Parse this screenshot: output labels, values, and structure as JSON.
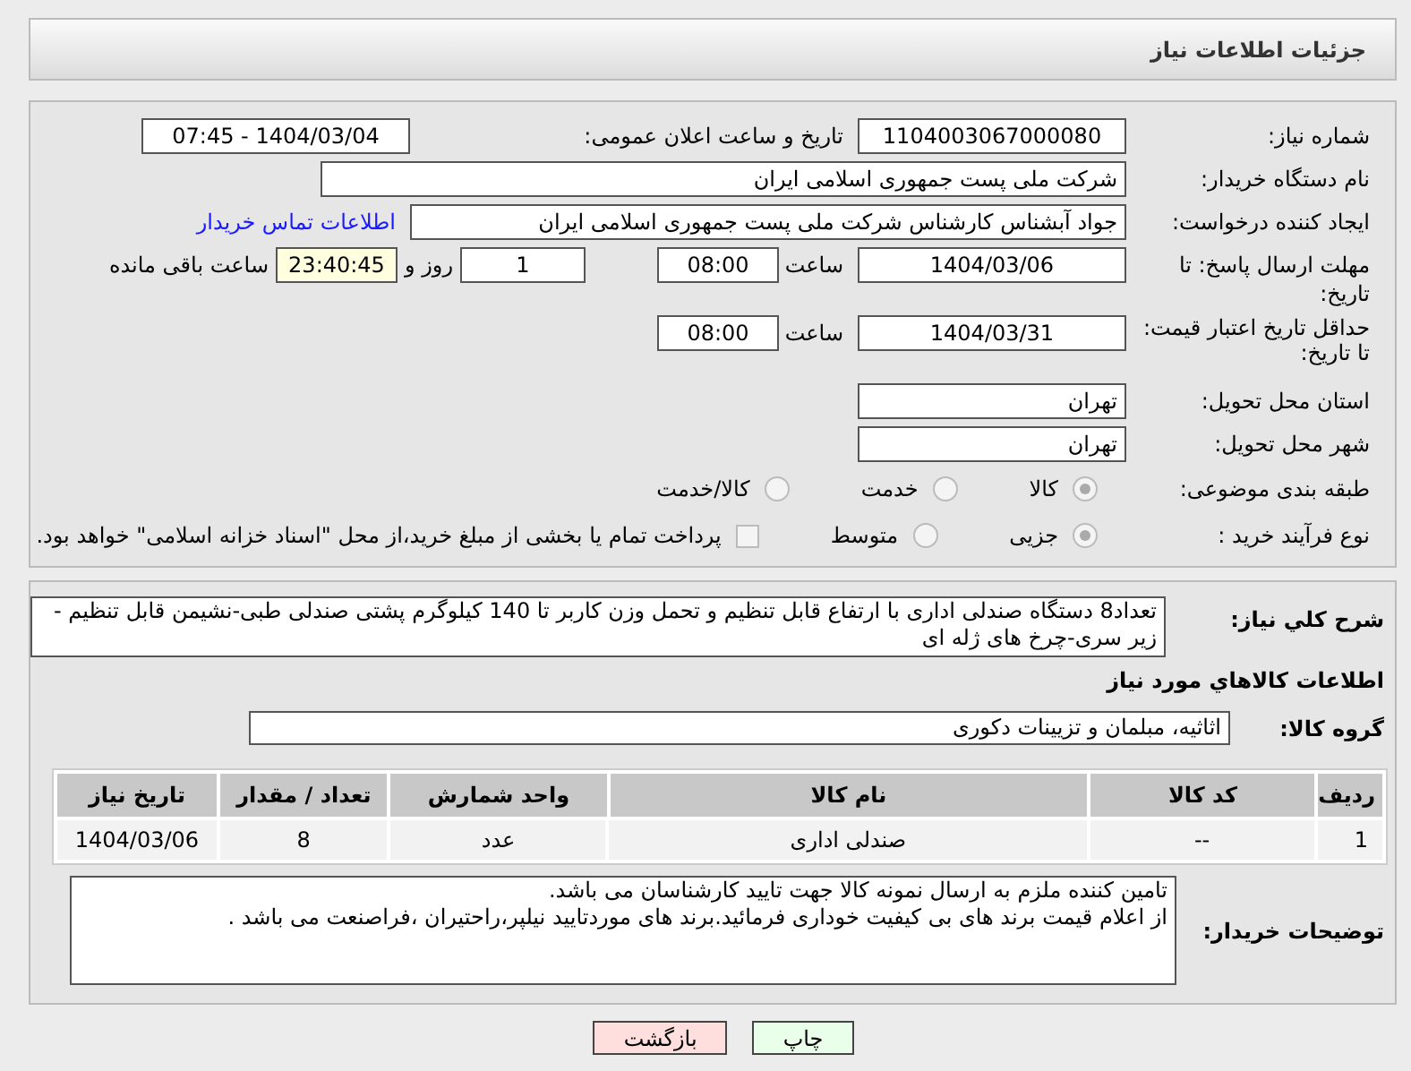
{
  "header": {
    "title": "جزئیات اطلاعات نیاز"
  },
  "need_number": {
    "label": "شماره نیاز:",
    "value": "1104003067000080"
  },
  "announce": {
    "label": "تاریخ و ساعت اعلان عمومی:",
    "value": "1404/03/04 - 07:45"
  },
  "buyer": {
    "label": "نام دستگاه خریدار:",
    "value": "شرکت ملی پست جمهوری اسلامی ایران"
  },
  "creator": {
    "label": "ایجاد کننده درخواست:",
    "value": "جواد آبشناس کارشناس شرکت ملی پست جمهوری اسلامی ایران",
    "link": "اطلاعات تماس خریدار"
  },
  "deadline": {
    "label": "مهلت ارسال پاسخ: تا تاریخ:",
    "date": "1404/03/06",
    "time_label": "ساعت",
    "time": "08:00",
    "days": "1",
    "days_label": "روز و",
    "remaining": "23:40:45",
    "remaining_label": "ساعت باقی مانده"
  },
  "validity": {
    "label": "حداقل تاریخ اعتبار قیمت: تا تاریخ:",
    "date": "1404/03/31",
    "time_label": "ساعت",
    "time": "08:00"
  },
  "province": {
    "label": "استان محل تحویل:",
    "value": "تهران"
  },
  "city": {
    "label": "شهر محل تحویل:",
    "value": "تهران"
  },
  "category": {
    "label": "طبقه بندی موضوعی:",
    "options": [
      {
        "label": "کالا",
        "selected": true
      },
      {
        "label": "خدمت",
        "selected": false
      },
      {
        "label": "کالا/خدمت",
        "selected": false
      }
    ]
  },
  "process": {
    "label": "نوع فرآیند خرید :",
    "options": [
      {
        "label": "جزیی",
        "selected": true
      },
      {
        "label": "متوسط",
        "selected": false
      }
    ],
    "payment": {
      "checked": false,
      "text": "پرداخت تمام یا بخشی از مبلغ خرید،از محل \"اسناد خزانه اسلامی\" خواهد بود."
    }
  },
  "description": {
    "label": "شرح کلي نياز:",
    "value": "تعداد8 دستگاه صندلی اداری با ارتفاع قابل تنظیم و تحمل وزن کاربر تا 140 کیلوگرم پشتی صندلی طبی-نشیمن قابل تنظیم - زیر سری-چرخ های ژله ای"
  },
  "goods_title": "اطلاعات کالاهاي مورد نياز",
  "goods_group": {
    "label": "گروه کالا:",
    "value": "اثاثیه، مبلمان و تزیینات دکوری"
  },
  "table": {
    "columns": [
      "ردیف",
      "کد کالا",
      "نام کالا",
      "واحد شمارش",
      "تعداد / مقدار",
      "تاریخ نیاز"
    ],
    "rows": [
      [
        "1",
        "--",
        "صندلی اداری",
        "عدد",
        "8",
        "1404/03/06"
      ]
    ]
  },
  "notes": {
    "label": "توضیحات خریدار:",
    "lines": [
      "تامین کننده ملزم به ارسال نمونه کالا جهت تایید کارشناسان می باشد.",
      "از اعلام قیمت برند های بی کیفیت خوداری فرمائید.برند های موردتایید نیلپر،راحتیران ،فراصنعت می باشد ."
    ]
  },
  "buttons": [
    {
      "label": "چاپ",
      "kind": "print"
    },
    {
      "label": "بازگشت",
      "kind": "back"
    }
  ]
}
